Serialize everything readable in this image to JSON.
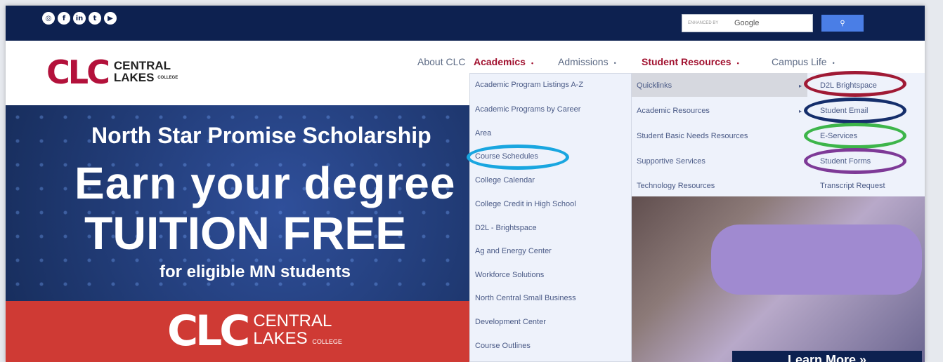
{
  "topbar": {
    "social_icons": [
      "instagram-icon",
      "facebook-icon",
      "linkedin-icon",
      "twitter-icon",
      "youtube-icon"
    ],
    "search": {
      "placeholder": "ENHANCED BY Google",
      "button_icon": "search-icon"
    }
  },
  "logo": {
    "mark": "CLC",
    "line1": "CENTRAL",
    "line2": "LAKES",
    "small": "COLLEGE"
  },
  "nav": {
    "about": "About CLC",
    "academics": "Academics",
    "admissions": "Admissions",
    "student_resources": "Student Resources",
    "campus_life": "Campus Life",
    "bullet": "•"
  },
  "academics_menu": [
    "Academic Program Listings A-Z",
    "Academic Programs by Career",
    "Area",
    "Course Schedules",
    "College Calendar",
    "College Credit in High School",
    "D2L - Brightspace",
    "Ag and Energy Center",
    "Workforce Solutions",
    "North Central Small Business",
    "Development Center",
    "Course Outlines"
  ],
  "student_resources_menu": [
    "Quicklinks",
    "Academic Resources",
    "Student Basic Needs Resources",
    "Supportive Services",
    "Technology Resources"
  ],
  "quicklinks_menu": [
    "D2L Brightspace",
    "Student Email",
    "E-Services",
    "Student Forms",
    "Transcript Request"
  ],
  "hero": {
    "scholarship": "North Star Promise Scholarship",
    "earn": "Earn your degree",
    "tuition": "TUITION FREE",
    "eligible": "for eligible MN students",
    "learn_more": "Learn More »"
  },
  "colors": {
    "navy": "#0d2150",
    "brand_red": "#b3113b",
    "ring_red": "#a01a35",
    "ring_navy": "#152e6b",
    "ring_green": "#3db54a",
    "ring_purple": "#7e3a97",
    "ring_cyan": "#19a6e0"
  }
}
